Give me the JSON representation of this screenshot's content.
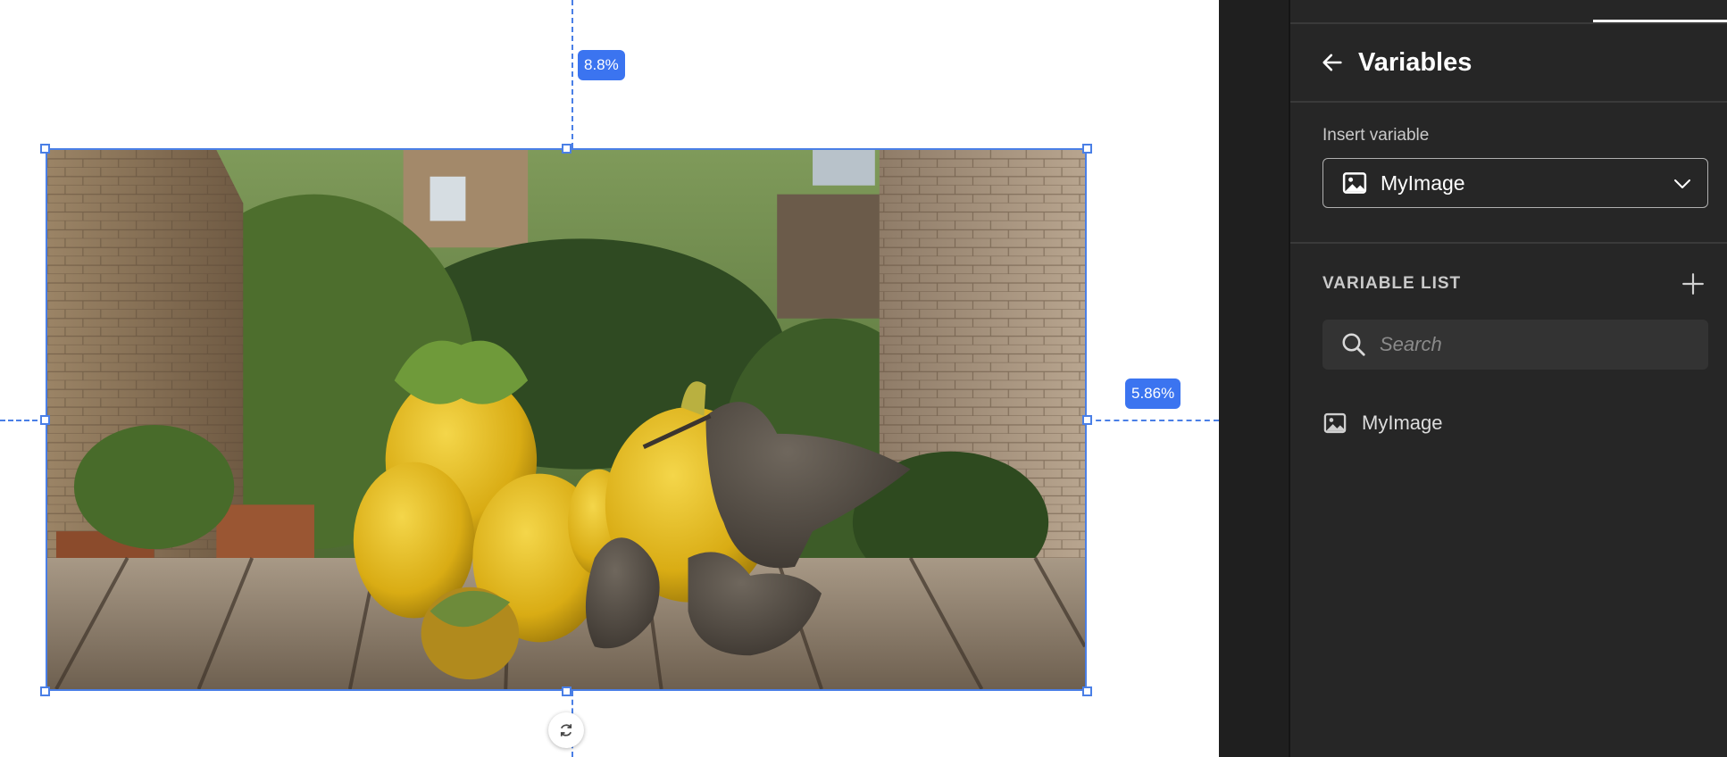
{
  "canvas": {
    "top_margin_label": "8.8%",
    "right_margin_label": "5.86%",
    "image_variable": "MyImage"
  },
  "panel": {
    "title": "Variables",
    "insert_label": "Insert variable",
    "selected_variable": "MyImage",
    "list_heading": "VARIABLE LIST",
    "search_placeholder": "Search",
    "variables": [
      {
        "name": "MyImage",
        "type": "image"
      }
    ]
  },
  "colors": {
    "accent": "#3b74f0",
    "panel_bg": "#262626",
    "gutter_bg": "#1f1f1f"
  },
  "icons": {
    "back": "arrow-left-icon",
    "select_type": "image-icon",
    "chevron": "chevron-down-icon",
    "add": "plus-icon",
    "search": "search-icon",
    "rotate": "rotate-icon"
  }
}
